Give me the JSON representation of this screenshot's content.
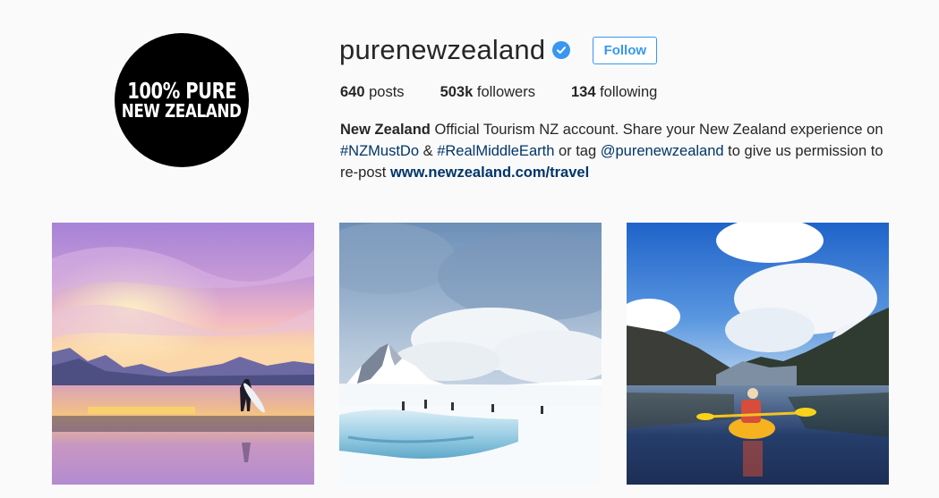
{
  "profile": {
    "avatar_text_line1": "100% PURE",
    "avatar_text_line2": "NEW ZEALAND",
    "username": "purenewzealand",
    "verified_icon": "verified-badge-icon",
    "follow_label": "Follow"
  },
  "stats": {
    "posts_count": "640",
    "posts_label": " posts",
    "followers_count": "503k",
    "followers_label": " followers",
    "following_count": "134",
    "following_label": " following"
  },
  "bio": {
    "name": "New Zealand",
    "text1": " Official Tourism NZ account. Share your New Zealand experience on ",
    "hashtag1": "#NZMustDo",
    "text2": " & ",
    "hashtag2": "#RealMiddleEarth",
    "text3": " or tag ",
    "mention": "@purenewzealand",
    "text4": " to give us permission to re-post ",
    "website": "www.newzealand.com/travel"
  },
  "colors": {
    "accent": "#3897f0",
    "link": "#003569",
    "background": "#fafafa"
  }
}
